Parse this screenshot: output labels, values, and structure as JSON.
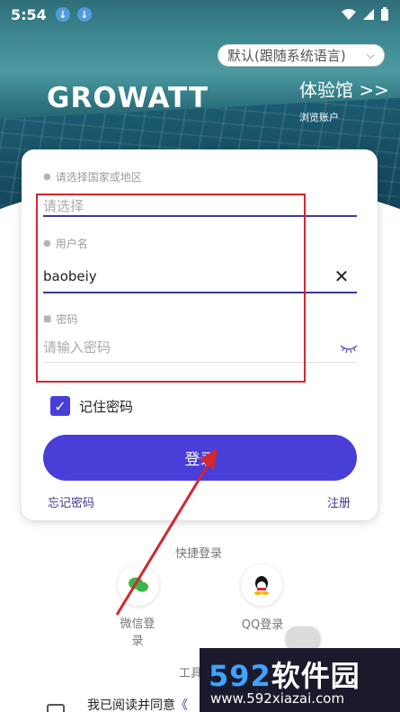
{
  "status_bar": {
    "time": "5:54"
  },
  "header": {
    "language": "默认(跟随系统语言)",
    "logo": "GROWATT",
    "demo_title": "体验馆 >>",
    "demo_subtitle": "浏览账户"
  },
  "form": {
    "region_label": "请选择国家或地区",
    "region_placeholder": "请选择",
    "username_label": "用户名",
    "username_value": "baobeiy",
    "password_label": "密码",
    "password_placeholder": "请输入密码",
    "remember_label": "记住密码",
    "remember_checked": true,
    "login_label": "登录",
    "forgot_label": "忘记密码",
    "register_label": "注册"
  },
  "quick_login": {
    "title": "快捷登录",
    "wechat_label": "微信登录",
    "qq_label": "QQ登录",
    "tools_label": "工具"
  },
  "agreement": {
    "text": "我已阅读并同意",
    "link": "《"
  },
  "watermark": {
    "brand_number": "592",
    "brand_text": "软件园",
    "url": "www.592xiazai.com"
  },
  "colors": {
    "accent": "#4a3ed9",
    "highlight": "#d4262f"
  },
  "icons": [
    "download-icon",
    "wifi-icon",
    "battery-icon",
    "globe-icon",
    "user-icon",
    "lock-icon",
    "clear-icon",
    "eye-closed-icon",
    "check-icon",
    "wechat-icon",
    "qq-icon"
  ]
}
